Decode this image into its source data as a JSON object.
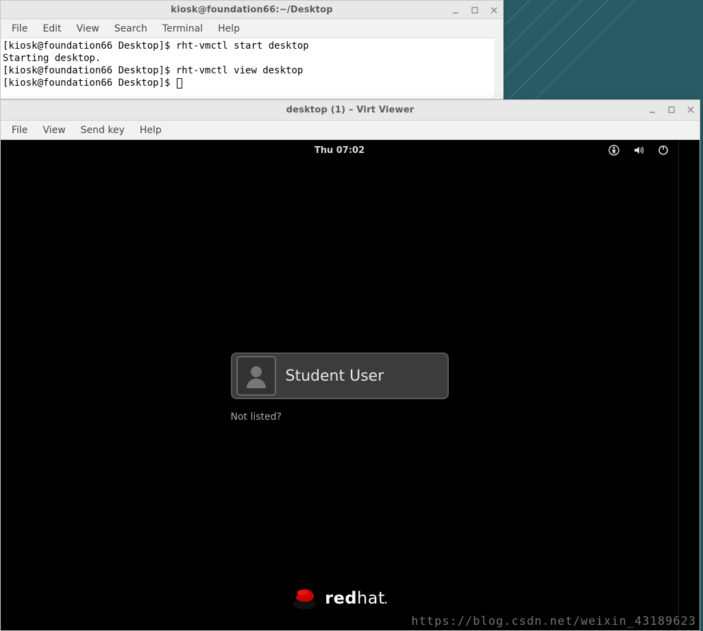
{
  "terminal": {
    "title": "kiosk@foundation66:~/Desktop",
    "menus": {
      "file": "File",
      "edit": "Edit",
      "view": "View",
      "search": "Search",
      "terminal": "Terminal",
      "help": "Help"
    },
    "lines": [
      {
        "prompt": "[kiosk@foundation66 Desktop]$ ",
        "cmd": "rht-vmctl start desktop"
      },
      {
        "text": "Starting desktop."
      },
      {
        "prompt": "[kiosk@foundation66 Desktop]$ ",
        "cmd": "rht-vmctl view desktop"
      },
      {
        "prompt": "[kiosk@foundation66 Desktop]$ ",
        "cmd": ""
      }
    ]
  },
  "viewer": {
    "title": "desktop (1) – Virt Viewer",
    "menus": {
      "file": "File",
      "view": "View",
      "sendkey": "Send key",
      "help": "Help"
    }
  },
  "vm": {
    "clock": "Thu 07:02",
    "login": {
      "user_display": "Student User",
      "not_listed": "Not listed?"
    },
    "brand": {
      "bold": "red",
      "rest": "hat"
    }
  },
  "watermark": "https://blog.csdn.net/weixin_43189623"
}
